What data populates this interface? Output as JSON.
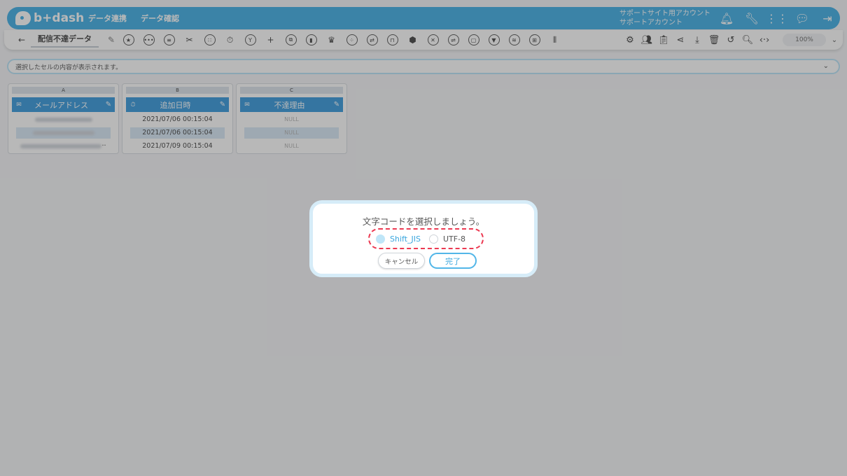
{
  "app": {
    "logo_text": "b+dash"
  },
  "nav": {
    "items": [
      "データ連携",
      "データ確認"
    ]
  },
  "account": {
    "line1": "サポートサイト用アカウント",
    "line2": "サポートアカウント"
  },
  "header_icons": [
    "bell-icon",
    "wrench-icon",
    "apps-icon",
    "chat-icon",
    "logout-icon"
  ],
  "toolbar": {
    "sheet_name": "配信不達データ",
    "zoom": "100%"
  },
  "formula_bar": {
    "placeholder": "選択したセルの内容が表示されます。"
  },
  "columns": [
    {
      "letter": "A",
      "header": "メールアドレス",
      "cells": [
        {
          "text": "",
          "selected": false
        },
        {
          "text": "",
          "selected": true
        },
        {
          "text": "··",
          "selected": false
        }
      ]
    },
    {
      "letter": "B",
      "header": "追加日時",
      "cells": [
        {
          "text": "2021/07/06 00:15:04",
          "selected": false
        },
        {
          "text": "2021/07/06 00:15:04",
          "selected": true
        },
        {
          "text": "2021/07/09 00:15:04",
          "selected": false
        }
      ]
    },
    {
      "letter": "C",
      "header": "不達理由",
      "cells": [
        {
          "text": "NULL",
          "selected": false
        },
        {
          "text": "NULL",
          "selected": true
        },
        {
          "text": "NULL",
          "selected": false
        }
      ]
    }
  ],
  "dialog": {
    "title": "文字コードを選択しましょう。",
    "options": [
      {
        "label": "Shift_JIS",
        "checked": true
      },
      {
        "label": "UTF-8",
        "checked": false
      }
    ],
    "cancel_label": "キャンセル",
    "ok_label": "完了"
  },
  "colors": {
    "brand": "#52b6e8",
    "highlight": "#ec3a52",
    "column_header": "#4aa3e0"
  }
}
